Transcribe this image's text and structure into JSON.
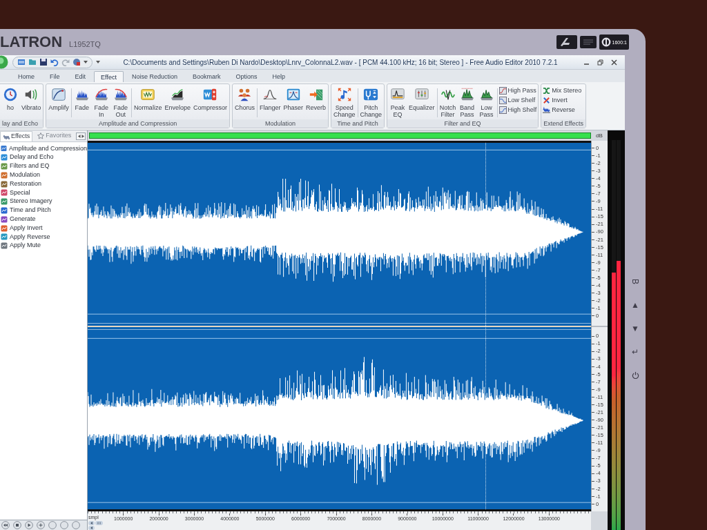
{
  "monitor": {
    "brand": "LATRON",
    "model": "L1952TQ",
    "badge_text": "1600:1",
    "buttons": [
      "B",
      "▲",
      "▼",
      "↵"
    ]
  },
  "window": {
    "title": "C:\\Documents and Settings\\Ruben Di Nardo\\Desktop\\Lnrv_ColonnaL2.wav - [ PCM 44.100 kHz; 16 bit; Stereo ] - Free Audio Editor 2010 7.2.1"
  },
  "tabs": [
    {
      "label": "Home",
      "selected": false
    },
    {
      "label": "File",
      "selected": false
    },
    {
      "label": "Edit",
      "selected": false
    },
    {
      "label": "Effect",
      "selected": true
    },
    {
      "label": "Noise Reduction",
      "selected": false
    },
    {
      "label": "Bookmark",
      "selected": false
    },
    {
      "label": "Options",
      "selected": false
    },
    {
      "label": "Help",
      "selected": false
    }
  ],
  "ribbon": [
    {
      "label": "lay and Echo",
      "sections": [
        {
          "kind": "large",
          "buttons": [
            "ho",
            "Vibrato"
          ]
        }
      ]
    },
    {
      "label": "Amplitude and Compression",
      "sections": [
        {
          "kind": "large",
          "buttons": [
            "Amplify"
          ]
        },
        {
          "kind": "large",
          "buttons": [
            "Fade",
            "Fade In",
            "Fade Out"
          ]
        },
        {
          "kind": "large",
          "buttons": [
            "Normalize",
            "Envelope",
            "Compressor"
          ]
        }
      ]
    },
    {
      "label": "Modulation",
      "sections": [
        {
          "kind": "large",
          "buttons": [
            "Chorus"
          ]
        },
        {
          "kind": "large",
          "buttons": [
            "Flanger",
            "Phaser",
            "Reverb"
          ]
        }
      ]
    },
    {
      "label": "Time and Pitch",
      "sections": [
        {
          "kind": "large",
          "buttons": [
            "Speed Change"
          ]
        },
        {
          "kind": "large",
          "buttons": [
            "Pitch Change"
          ]
        }
      ]
    },
    {
      "label": "Filter and EQ",
      "sections": [
        {
          "kind": "large",
          "buttons": [
            "Peak EQ",
            "Equalizer"
          ]
        },
        {
          "kind": "large",
          "buttons": [
            "Notch Filter",
            "Band Pass",
            "Low Pass"
          ]
        },
        {
          "kind": "small",
          "buttons": [
            "High Pass",
            "Low Shelf",
            "High Shelf"
          ]
        }
      ]
    },
    {
      "label": "Extend Effects",
      "sections": [
        {
          "kind": "small",
          "buttons": [
            "Mix Stereo",
            "Invert",
            "Reverse"
          ]
        }
      ]
    }
  ],
  "sidebar": {
    "tabs": [
      {
        "label": "Effects",
        "selected": true
      },
      {
        "label": "Favorites",
        "selected": false
      }
    ],
    "items": [
      "Amplitude and Compression",
      "Delay and Echo",
      "Filters and EQ",
      "Modulation",
      "Restoration",
      "Special",
      "Stereo Imagery",
      "Time and Pitch",
      "Generate",
      "Apply Invert",
      "Apply Reverse",
      "Apply Mute"
    ]
  },
  "editor": {
    "unit": "dB",
    "channels": [
      {
        "scale": [
          "0",
          "-1",
          "-2",
          "-3",
          "-4",
          "-5",
          "-7",
          "-9",
          "-11",
          "-15",
          "-21",
          "-90",
          "-21",
          "-15",
          "-11",
          "-9",
          "-7",
          "-5",
          "-4",
          "-3",
          "-2",
          "-1",
          "0"
        ]
      },
      {
        "scale": [
          "0",
          "-1",
          "-2",
          "-3",
          "-4",
          "-5",
          "-7",
          "-9",
          "-11",
          "-15",
          "-21",
          "-90",
          "-21",
          "-15",
          "-11",
          "-9",
          "-7",
          "-5",
          "-4",
          "-3",
          "-2",
          "-1",
          "0"
        ]
      }
    ],
    "ruler": {
      "unit": "smpl",
      "ticks": [
        "1000000",
        "2000000",
        "3000000",
        "4000000",
        "5000000",
        "6000000",
        "7000000",
        "8000000",
        "9000000",
        "10000000",
        "11000000",
        "12000000",
        "13000000"
      ]
    }
  },
  "meters": [
    {
      "level": 0.66
    },
    {
      "level": 0.69
    }
  ]
}
